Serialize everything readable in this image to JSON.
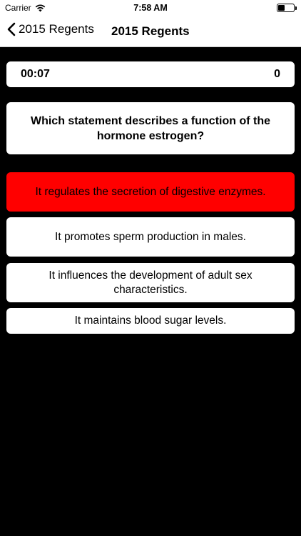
{
  "status_bar": {
    "carrier": "Carrier",
    "time": "7:58 AM",
    "wifi_icon": "wifi-icon",
    "battery_icon": "battery-icon",
    "battery_level": 0.45
  },
  "nav": {
    "back_label": "2015 Regents",
    "title": "2015 Regents"
  },
  "quiz": {
    "timer": "00:07",
    "score": "0",
    "question": "Which statement describes a function of the hormone estrogen?",
    "answers": [
      {
        "text": "It regulates the secretion of digestive enzymes.",
        "state": "wrong"
      },
      {
        "text": "It promotes sperm production in males.",
        "state": "default"
      },
      {
        "text": "It influences the development of adult sex characteristics.",
        "state": "default"
      },
      {
        "text": "It maintains blood sugar levels.",
        "state": "default"
      }
    ],
    "colors": {
      "wrong": "#ff0000",
      "card": "#ffffff",
      "background": "#000000"
    }
  }
}
